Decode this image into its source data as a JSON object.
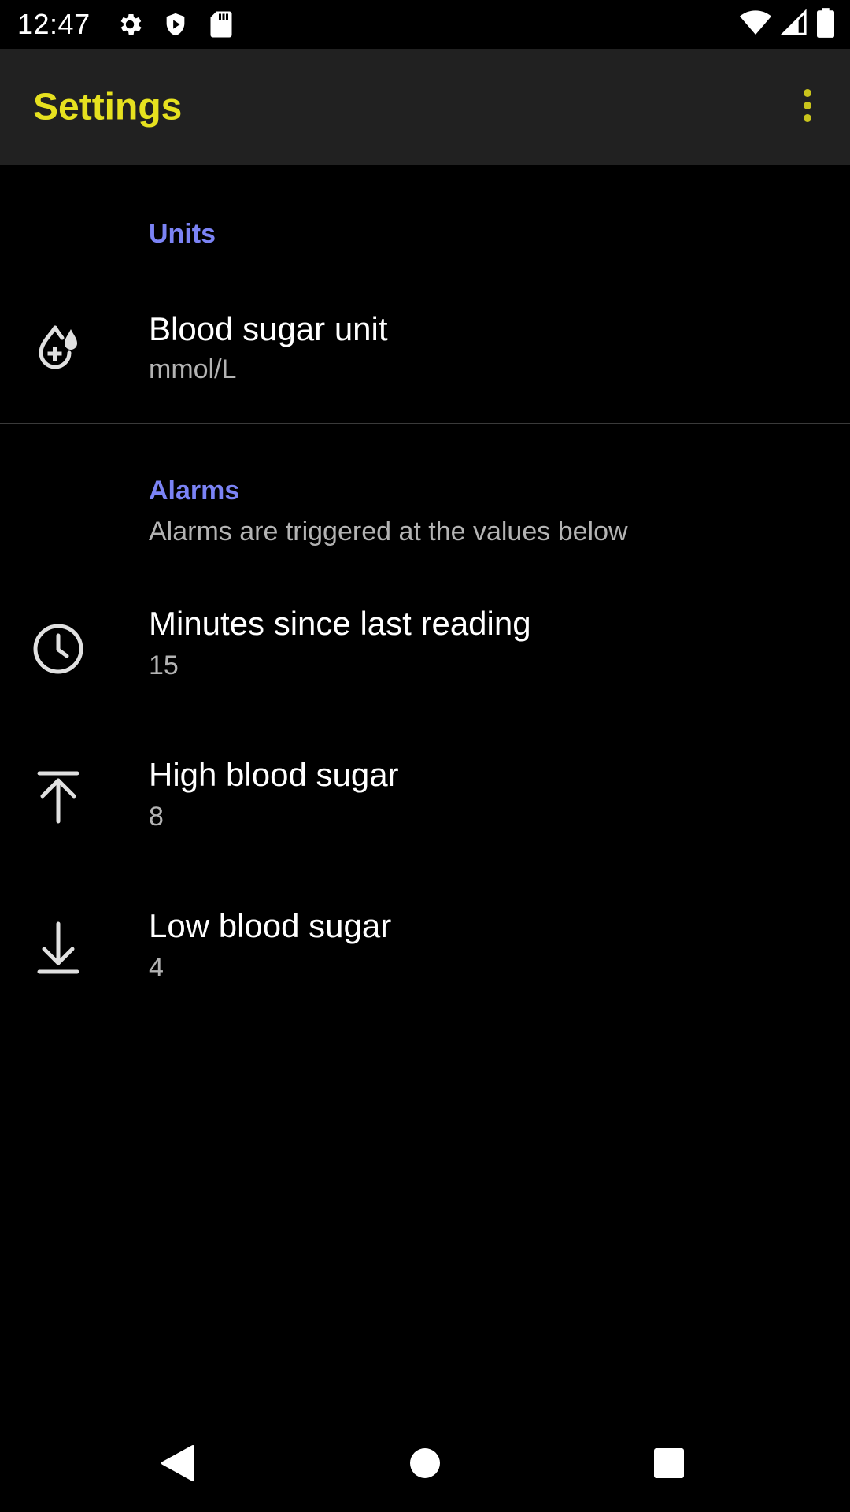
{
  "status_bar": {
    "time": "12:47",
    "icons_left": [
      "gear-icon",
      "shield-icon",
      "sd-card-icon"
    ],
    "icons_right": [
      "wifi-icon",
      "signal-icon",
      "battery-icon"
    ]
  },
  "app_bar": {
    "title": "Settings",
    "title_color": "#e6e11f",
    "overflow_icon": "more-vert-icon"
  },
  "sections": {
    "units": {
      "title": "Units",
      "items": [
        {
          "icon": "blood-drop-plus-icon",
          "title": "Blood sugar unit",
          "summary": "mmol/L"
        }
      ]
    },
    "alarms": {
      "title": "Alarms",
      "summary": "Alarms are triggered at the values below",
      "items": [
        {
          "icon": "clock-icon",
          "title": "Minutes since last reading",
          "summary": "15"
        },
        {
          "icon": "arrow-up-to-line-icon",
          "title": "High blood sugar",
          "summary": "8"
        },
        {
          "icon": "arrow-down-to-line-icon",
          "title": "Low blood sugar",
          "summary": "4"
        }
      ]
    }
  },
  "colors": {
    "accent_category": "#7b83f5",
    "app_bar_bg": "#212121",
    "background": "#000000"
  },
  "nav_bar": {
    "icons": [
      "back-icon",
      "home-icon",
      "recents-icon"
    ]
  }
}
